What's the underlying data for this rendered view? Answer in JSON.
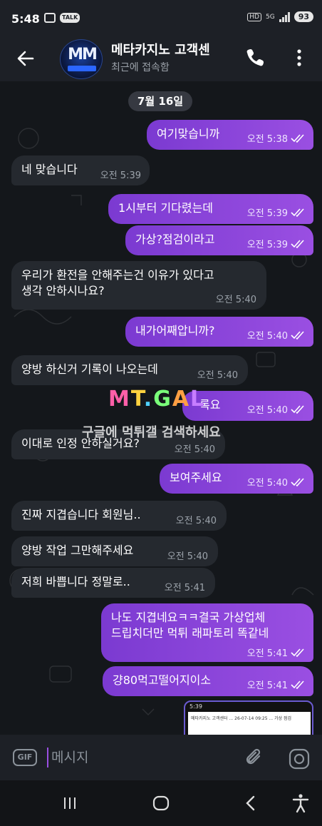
{
  "status_bar": {
    "time": "5:48",
    "talk_badge": "TALK",
    "hd": "HD",
    "network": "5G",
    "battery": "93"
  },
  "header": {
    "title": "메타카지노 고객센",
    "subtitle": "최근에 접속함",
    "avatar_icon": "metacasino-logo",
    "back_icon": "arrow-left-icon",
    "call_icon": "phone-icon",
    "menu_icon": "more-vertical-icon"
  },
  "chat": {
    "date_chip": "7월 16일",
    "messages": [
      {
        "dir": "out",
        "text": "여기맞습니까",
        "time": "오전 5:38"
      },
      {
        "dir": "in",
        "text": "네 맞습니다",
        "time": "오전 5:39"
      },
      {
        "dir": "out",
        "text": "1시부터 기다렸는데",
        "time": "오전 5:39"
      },
      {
        "dir": "out",
        "text": "가상?점검이라고",
        "time": "오전 5:39"
      },
      {
        "dir": "in",
        "text": "우리가 환전을 안해주는건 이유가 있다고",
        "text2": "생각 안하시나요?",
        "time": "오전 5:40"
      },
      {
        "dir": "out",
        "text": "내가어째압니까?",
        "time": "오전 5:40"
      },
      {
        "dir": "in",
        "text": "양방 하신거 기록이 나오는데",
        "time": "오전 5:40"
      },
      {
        "dir": "out",
        "text": "록요",
        "time": "오전 5:40"
      },
      {
        "dir": "in",
        "text": "이대로 인정 안하실거요?",
        "time": "오전 5:40"
      },
      {
        "dir": "out",
        "text": "보여주세요",
        "time": "오전 5:40"
      },
      {
        "dir": "in",
        "text": "진짜 지겹습니다 회원님..",
        "time": "오전 5:40"
      },
      {
        "dir": "in",
        "text": "양방 작업 그만해주세요",
        "time": "오전 5:40"
      },
      {
        "dir": "in",
        "text": "저희 바쁩니다 정말로..",
        "time": "오전 5:41"
      },
      {
        "dir": "out",
        "text": "나도 지겹네요ㅋㅋ결국 가상업체",
        "text2": "드립치더만 먹튀 래파토리 똑같네",
        "time": "오전 5:41"
      },
      {
        "dir": "out",
        "text": "걍80먹고떨어지이소",
        "time": "오전 5:41"
      }
    ],
    "thumbnail": {
      "time": "5:39",
      "caption": "메타카지노 고객센터 ... 26-07-14 09:25 ... 가상 점검"
    }
  },
  "watermark": {
    "logo": "MTGAL",
    "text": "구글에 먹튀갤 검색하세요"
  },
  "input_bar": {
    "gif_label": "GIF",
    "placeholder": "메시지"
  },
  "colors": {
    "outgoing_bubble": "#8a45da",
    "incoming_bubble": "#25292f",
    "background": "#14171b"
  }
}
